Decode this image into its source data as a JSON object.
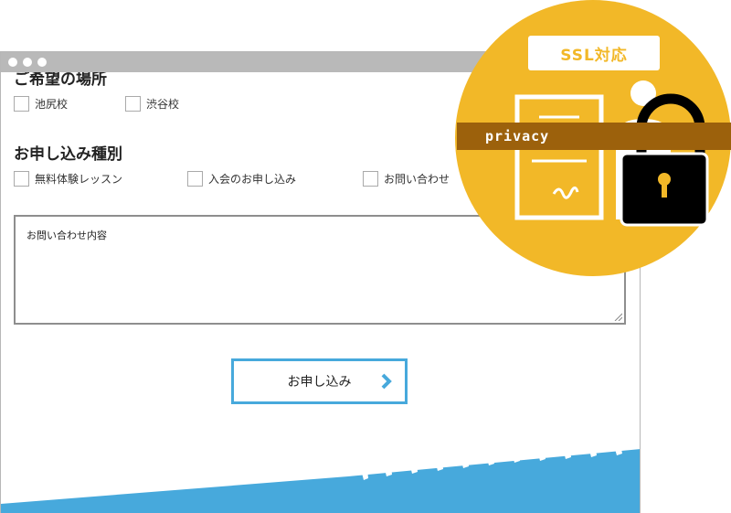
{
  "form": {
    "location": {
      "heading": "ご希望の場所",
      "options": [
        "池尻校",
        "渋谷校"
      ]
    },
    "application_type": {
      "heading": "お申し込み種別",
      "options": [
        "無料体験レッスン",
        "入会のお申し込み",
        "お問い合わせ"
      ]
    },
    "inquiry_field": {
      "label": "お問い合わせ内容"
    },
    "submit_label": "お申し込み"
  },
  "badge": {
    "ssl_label": "SSL対応",
    "privacy_label": "privacy"
  },
  "colors": {
    "accent_blue": "#47a9dc",
    "badge_yellow": "#f2b828",
    "privacy_brown": "#9c610c",
    "window_chrome": "#b9b9b9"
  },
  "icons": {
    "submit_arrow": "chevron-right-icon",
    "lock": "padlock-icon",
    "document": "certificate-document-icon",
    "user": "user-silhouette-icon"
  }
}
